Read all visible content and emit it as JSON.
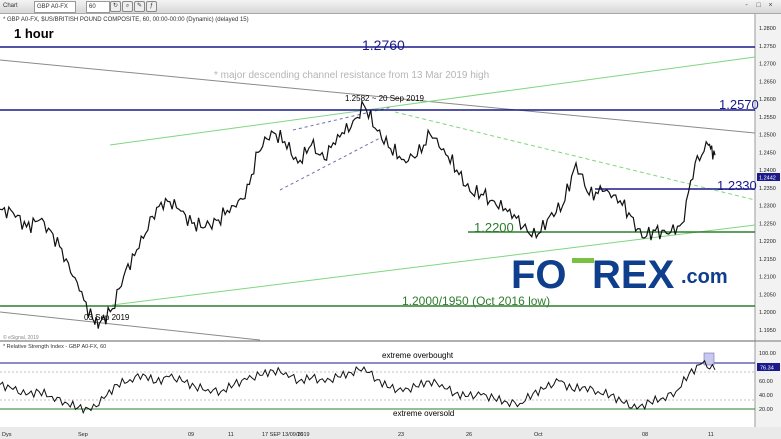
{
  "toolbar": {
    "chart_label": "Chart",
    "symbol": "GBP A0-FX",
    "interval": "60",
    "window_controls": [
      "-",
      "□",
      "×"
    ]
  },
  "header": {
    "series_desc": "* GBP A0-FX, $US/BRITISH POUND COMPOSITE, 60, 00:00-00:00 (Dynamic) (delayed 15)",
    "timeframe": "1 hour"
  },
  "watermark": "© eSignal, 2019",
  "brand": {
    "fo": "FO",
    "rex": "REX",
    "com": ".com"
  },
  "annotations": {
    "channel_note": "* major descending channel resistance from 13 Mar 2019 high",
    "peak_label": "1.2582 ~ 20 Sep 2019",
    "trough_label": "03 Sep 2019",
    "level_12760": "1.2760",
    "level_12570": "1.2570",
    "level_12330": "1.2330",
    "level_12200": "1.2200",
    "level_12000": "1.2000/1950 (Oct 2016 low)"
  },
  "rsi": {
    "title": "* Relative Strength Index - GBP A0-FX, 60",
    "overbought": "extreme overbought",
    "oversold": "extreme oversold",
    "last_value": "76.34",
    "axis": [
      "100.00",
      "80.00",
      "60.00",
      "40.00",
      "20.00",
      "0.00"
    ]
  },
  "colors": {
    "level_line": "#1a1a8c",
    "support": "#2e7d2e",
    "trend": "#7fd67f",
    "channel": "#8a8a8a",
    "current": "#1a1a8c",
    "brand_green": "#7ac142",
    "brand_blue": "#0f3f8c"
  },
  "chart_data": {
    "type": "line",
    "price_axis": [
      "1.2800",
      "1.2750",
      "1.2700",
      "1.2650",
      "1.2600",
      "1.2550",
      "1.2500",
      "1.2450",
      "1.2400",
      "1.2350",
      "1.2300",
      "1.2250",
      "1.2200",
      "1.2150",
      "1.2100",
      "1.2050",
      "1.2000",
      "1.1950"
    ],
    "ylim": [
      1.1925,
      1.2835
    ],
    "last_price": "1.2442",
    "time_labels": [
      "Dys",
      "Sep",
      "09",
      "11",
      "17 SEP 13/09/2019",
      "16",
      "23",
      "26",
      "Oct",
      "08",
      "11"
    ],
    "key_points": [
      {
        "x": "03 Sep 2019",
        "y": 1.1968
      },
      {
        "x": "20 Sep 2019",
        "y": 1.2582
      }
    ],
    "series": [
      {
        "name": "GBP A0-FX",
        "values": [
          [
            0,
            1.229
          ],
          [
            2,
            1.228
          ],
          [
            4,
            1.224
          ],
          [
            6,
            1.226
          ],
          [
            8,
            1.222
          ],
          [
            10,
            1.215
          ],
          [
            12,
            1.206
          ],
          [
            14,
            1.198
          ],
          [
            15,
            1.1968
          ],
          [
            17,
            1.201
          ],
          [
            19,
            1.212
          ],
          [
            21,
            1.218
          ],
          [
            23,
            1.227
          ],
          [
            25,
            1.232
          ],
          [
            27,
            1.229
          ],
          [
            29,
            1.225
          ],
          [
            31,
            1.224
          ],
          [
            33,
            1.226
          ],
          [
            35,
            1.23
          ],
          [
            37,
            1.232
          ],
          [
            39,
            1.245
          ],
          [
            41,
            1.251
          ],
          [
            43,
            1.248
          ],
          [
            45,
            1.242
          ],
          [
            47,
            1.247
          ],
          [
            49,
            1.243
          ],
          [
            51,
            1.25
          ],
          [
            53,
            1.252
          ],
          [
            55,
            1.2582
          ],
          [
            57,
            1.251
          ],
          [
            59,
            1.246
          ],
          [
            61,
            1.243
          ],
          [
            63,
            1.244
          ],
          [
            65,
            1.25
          ],
          [
            67,
            1.246
          ],
          [
            69,
            1.24
          ],
          [
            71,
            1.234
          ],
          [
            73,
            1.233
          ],
          [
            75,
            1.23
          ],
          [
            77,
            1.229
          ],
          [
            79,
            1.224
          ],
          [
            81,
            1.221
          ],
          [
            83,
            1.227
          ],
          [
            85,
            1.23
          ],
          [
            87,
            1.242
          ],
          [
            89,
            1.233
          ],
          [
            91,
            1.234
          ],
          [
            93,
            1.233
          ],
          [
            95,
            1.228
          ],
          [
            97,
            1.221
          ],
          [
            99,
            1.223
          ],
          [
            101,
            1.222
          ],
          [
            103,
            1.225
          ],
          [
            105,
            1.242
          ],
          [
            107,
            1.247
          ],
          [
            108,
            1.2442
          ]
        ]
      }
    ],
    "rsi_values": [
      55,
      48,
      40,
      45,
      38,
      30,
      22,
      18,
      35,
      55,
      62,
      70,
      58,
      66,
      60,
      52,
      48,
      45,
      55,
      62,
      68,
      75,
      72,
      60,
      65,
      58,
      66,
      72,
      80,
      62,
      50,
      45,
      52,
      60,
      55,
      42,
      38,
      40,
      35,
      30,
      28,
      42,
      50,
      60,
      48,
      52,
      45,
      40,
      28,
      20,
      30,
      36,
      45,
      70,
      85,
      76
    ]
  }
}
